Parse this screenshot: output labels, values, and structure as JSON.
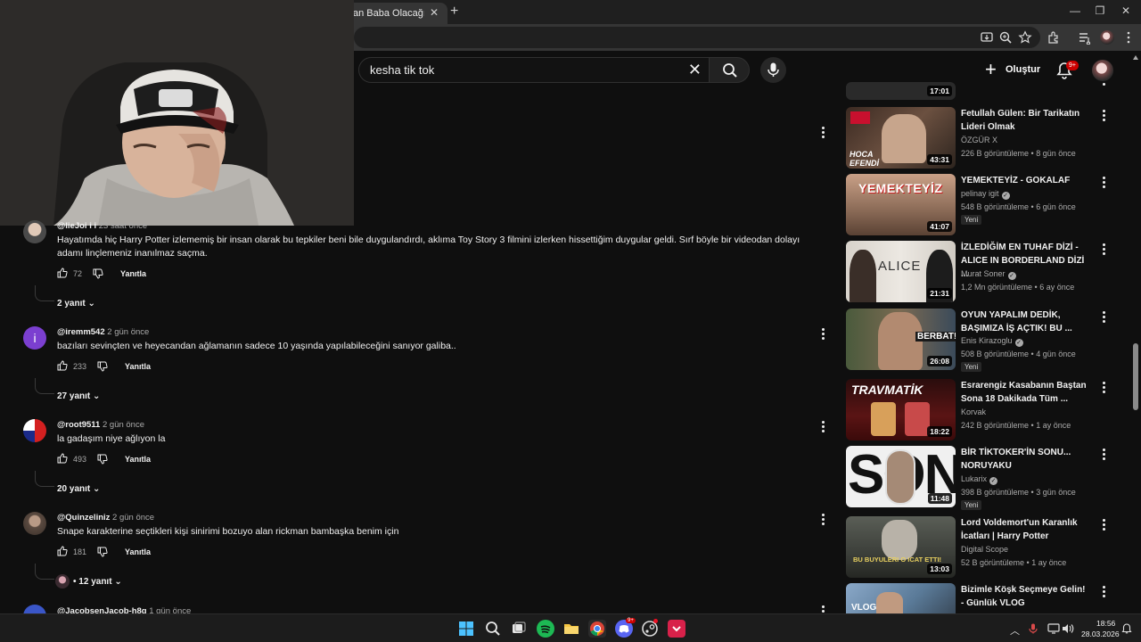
{
  "browser": {
    "tab_title": "an Baba Olacağını Açı",
    "close_glyph": "✕",
    "new_tab": "+",
    "window_controls": [
      "—",
      "❐",
      "✕"
    ]
  },
  "youtube_header": {
    "search_value": "kesha tik tok",
    "clear_glyph": "✕",
    "create_label": "Oluştur",
    "notification_badge": "9+"
  },
  "comments": [
    {
      "handle": "@lieJoi i i",
      "ago": "23 saat önce",
      "text": "Hayatımda hiç Harry Potter izlememiş bir insan olarak bu tepkiler beni bile duygulandırdı, aklıma Toy Story 3 filmini izlerken hissettiğim duygular geldi. Sırf böyle bir videodan dolayı adamı linçlemeniz inanılmaz saçma.",
      "likes": "72",
      "reply_label": "Yanıtla",
      "replies": "2 yanıt"
    },
    {
      "handle": "@iremm542",
      "ago": "2 gün önce",
      "text": "bazıları sevinçten ve heyecandan ağlamanın sadece 10 yaşında yapılabileceğini sanıyor galiba..",
      "likes": "233",
      "reply_label": "Yanıtla",
      "replies": "27 yanıt",
      "avatar_letter": "i"
    },
    {
      "handle": "@root9511",
      "ago": "2 gün önce",
      "text": "la gadaşım niye ağlıyon la",
      "likes": "493",
      "reply_label": "Yanıtla",
      "replies": "20 yanıt"
    },
    {
      "handle": "@Quinzeliniz",
      "ago": "2 gün önce",
      "text": "Snape karakterine seçtikleri kişi sinirimi bozuyo alan rickman bambaşka benim için",
      "likes": "181",
      "reply_label": "Yanıtla",
      "replies": "12 yanıt",
      "replies_prefix": "•"
    },
    {
      "handle": "@JacobsenJacob-h8g",
      "ago": "1 gün önce"
    }
  ],
  "sidebar": {
    "partial_top_duration": "17:01",
    "new_badge": "Yeni",
    "videos": [
      {
        "title": "Fetullah Gülen: Bir Tarikatın Lideri Olmak",
        "channel": "ÖZGÜR X",
        "verified": false,
        "meta": "226 B görüntüleme • 8 gün önce",
        "duration": "43:31",
        "is_new": false,
        "thumb_text": "HOCA EFENDİ"
      },
      {
        "title": "YEMEKTEYİZ - GOKALAF",
        "channel": "pelinay igit",
        "verified": true,
        "meta": "548 B görüntüleme • 6 gün önce",
        "duration": "41:07",
        "is_new": true,
        "thumb_text": "YEMEKTEYİZ"
      },
      {
        "title": "İZLEDİĞİM EN TUHAF DİZİ - ALICE IN BORDERLAND DİZİ ...",
        "channel": "Murat Soner",
        "verified": true,
        "meta": "1,2 Mn görüntüleme • 6 ay önce",
        "duration": "21:31",
        "is_new": false,
        "thumb_text": "ALICE"
      },
      {
        "title": "OYUN YAPALIM DEDİK, BAŞIMIZA İŞ AÇTIK! BU ...",
        "channel": "Enis Kirazoglu",
        "verified": true,
        "meta": "508 B görüntüleme • 4 gün önce",
        "duration": "26:08",
        "is_new": true,
        "thumb_text": "BERBAT!"
      },
      {
        "title": "Esrarengiz Kasabanın Baştan Sona 18 Dakikada Tüm ...",
        "channel": "Korvak",
        "verified": false,
        "meta": "242 B görüntüleme • 1 ay önce",
        "duration": "18:22",
        "is_new": false,
        "thumb_text": "TRAVMATİK"
      },
      {
        "title": "BİR TİKTOKER'İN SONU... NORUYAKU",
        "channel": "Lukarix",
        "verified": true,
        "meta": "398 B görüntüleme • 3 gün önce",
        "duration": "11:48",
        "is_new": true,
        "thumb_text": "SON"
      },
      {
        "title": "Lord Voldemort'un Karanlık İcatları | Harry Potter",
        "channel": "Digital Scope",
        "verified": false,
        "meta": "52 B görüntüleme • 1 ay önce",
        "duration": "13:03",
        "is_new": false,
        "thumb_text": "BU BUYULERI O ICAT ETTI!"
      },
      {
        "title": "Bizimle Köşk Seçmeye Gelin! - Günlük VLOG",
        "channel": "",
        "verified": false,
        "meta": "",
        "duration": "",
        "is_new": false,
        "thumb_text": "VLOG"
      }
    ]
  },
  "taskbar": {
    "discord_badge": "9+",
    "time": "18:56",
    "date": "28.03.2026",
    "tray_arrow": "︿"
  },
  "colors": {
    "background": "#0f0f0f",
    "accent_red": "#cc0000",
    "secondary_text": "#aaaaaa"
  }
}
